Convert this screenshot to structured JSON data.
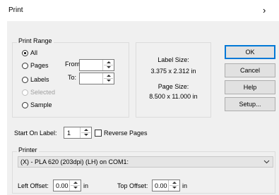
{
  "window": {
    "title": "Print",
    "close_glyph": "›"
  },
  "print_range": {
    "legend": "Print Range",
    "options": {
      "all": "All",
      "pages": "Pages",
      "labels": "Labels",
      "selected": "Selected",
      "sample": "Sample"
    },
    "selected_option": "all",
    "from_label": "From:",
    "to_label": "To:",
    "from_value": "",
    "to_value": ""
  },
  "info": {
    "label_size_title": "Label Size:",
    "label_size_value": "3.375 x 2.312 in",
    "page_size_title": "Page Size:",
    "page_size_value": "8.500 x 11.000 in"
  },
  "buttons": {
    "ok": "OK",
    "cancel": "Cancel",
    "help": "Help",
    "setup": "Setup..."
  },
  "start_on_label": {
    "label": "Start On Label:",
    "value": "1"
  },
  "reverse_pages": {
    "label": "Reverse Pages",
    "checked": false
  },
  "printer": {
    "legend": "Printer",
    "selected": "(X) - PLA 620 (203dpi) (LH) on COM1:",
    "left_offset_label": "Left Offset:",
    "left_offset_value": "0.00",
    "left_offset_unit": "in",
    "top_offset_label": "Top Offset:",
    "top_offset_value": "0.00",
    "top_offset_unit": "in"
  },
  "icons": {
    "close": "close-chevron-icon",
    "dropdown": "chevron-down-icon",
    "spin_up": "spin-up-icon",
    "spin_down": "spin-down-icon"
  },
  "colors": {
    "default_button_border": "#0078d7",
    "dialog_bg": "#f0f0f0"
  }
}
